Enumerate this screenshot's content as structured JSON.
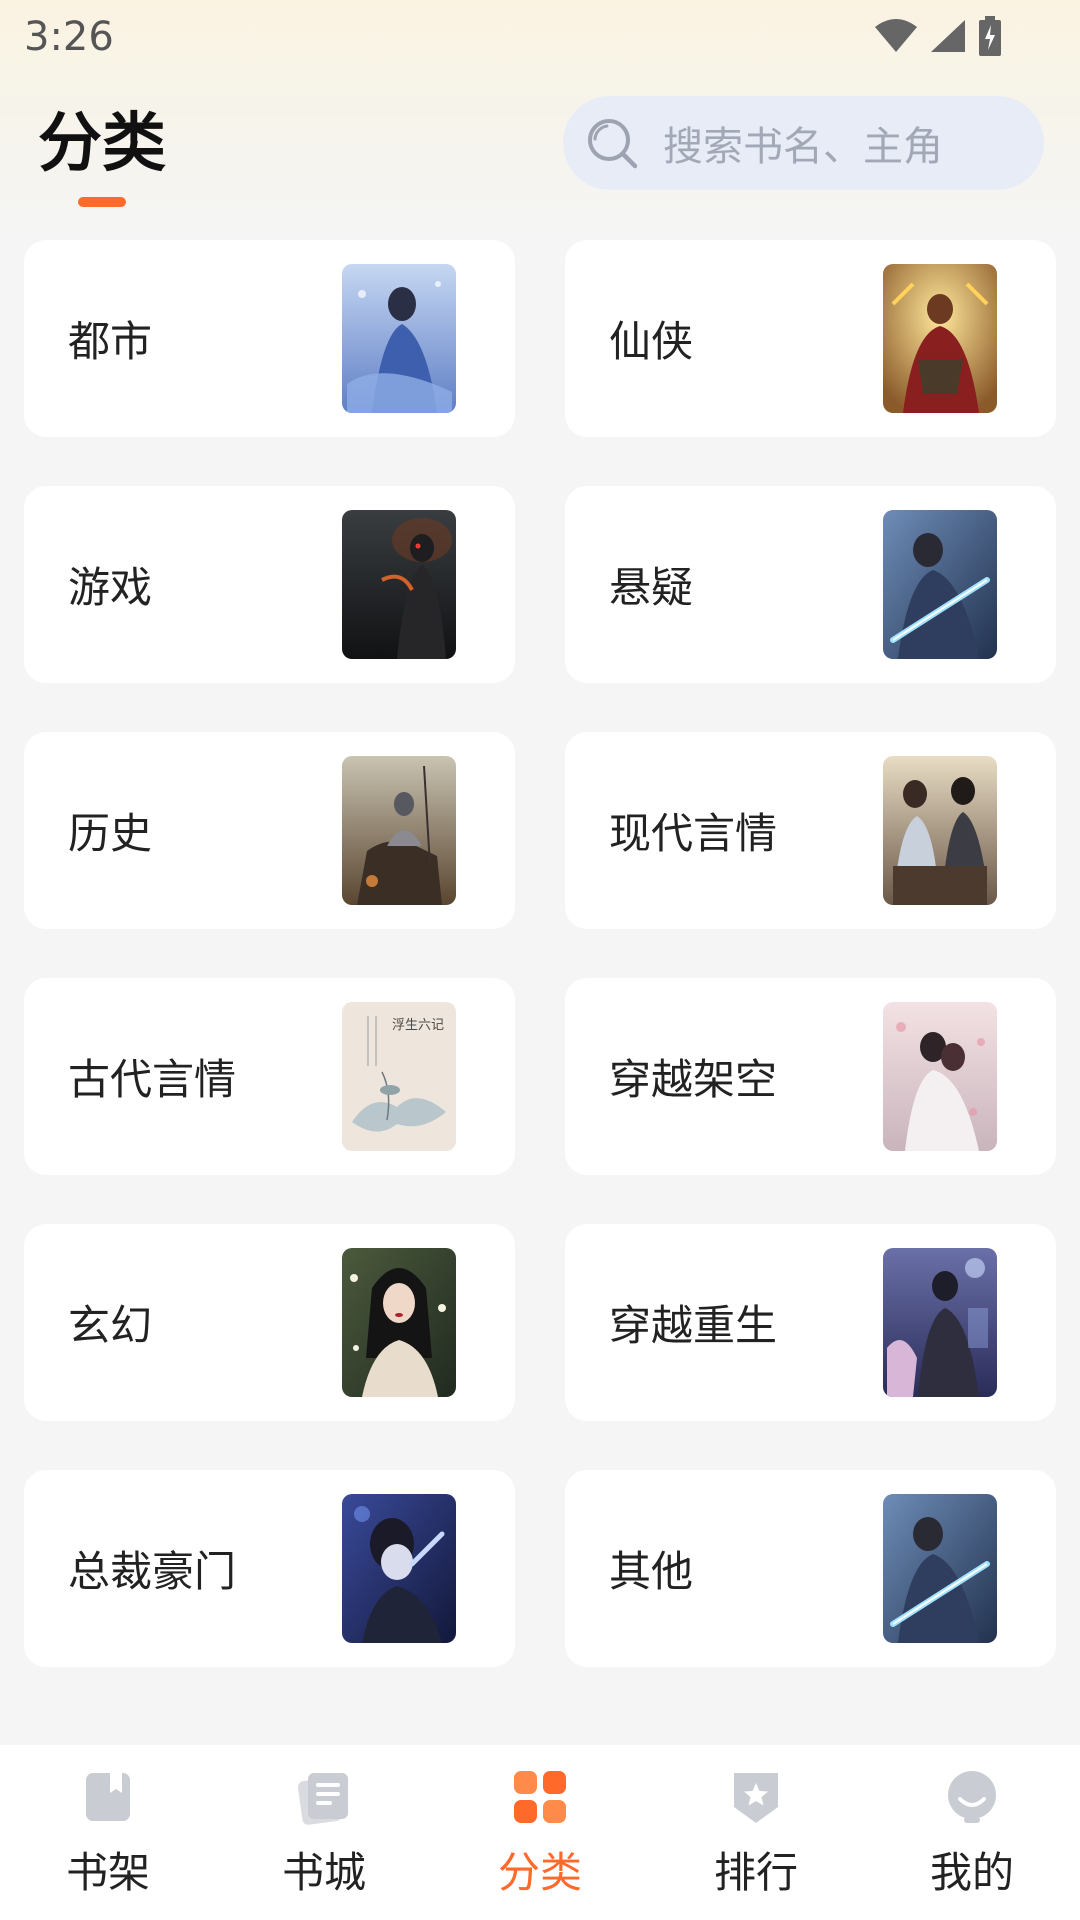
{
  "status_bar": {
    "time": "3:26",
    "icons": [
      "wifi-icon",
      "signal-icon",
      "battery-charging-icon"
    ]
  },
  "header": {
    "title": "分类",
    "accent_color": "#ff6a2b"
  },
  "search": {
    "placeholder": "搜索书名、主角",
    "icon": "search-icon"
  },
  "categories": [
    {
      "label": "都市",
      "cover": "cover-urban"
    },
    {
      "label": "仙侠",
      "cover": "cover-xianxia"
    },
    {
      "label": "游戏",
      "cover": "cover-game"
    },
    {
      "label": "悬疑",
      "cover": "cover-suspense"
    },
    {
      "label": "历史",
      "cover": "cover-history"
    },
    {
      "label": "现代言情",
      "cover": "cover-modern-romance"
    },
    {
      "label": "古代言情",
      "cover": "cover-ancient-romance"
    },
    {
      "label": "穿越架空",
      "cover": "cover-time-travel-fictional"
    },
    {
      "label": "玄幻",
      "cover": "cover-fantasy"
    },
    {
      "label": "穿越重生",
      "cover": "cover-time-travel-rebirth"
    },
    {
      "label": "总裁豪门",
      "cover": "cover-ceo"
    },
    {
      "label": "其他",
      "cover": "cover-other"
    }
  ],
  "ancient_romance_cover_text": {
    "title": "浮生六记"
  },
  "bottom_nav": {
    "items": [
      {
        "label": "书架",
        "icon": "bookshelf-icon",
        "active": false
      },
      {
        "label": "书城",
        "icon": "bookstore-icon",
        "active": false
      },
      {
        "label": "分类",
        "icon": "category-icon",
        "active": true
      },
      {
        "label": "排行",
        "icon": "ranking-icon",
        "active": false
      },
      {
        "label": "我的",
        "icon": "profile-icon",
        "active": false
      }
    ],
    "active_color": "#ff6a2b",
    "inactive_icon_color": "#c9ccd2"
  }
}
